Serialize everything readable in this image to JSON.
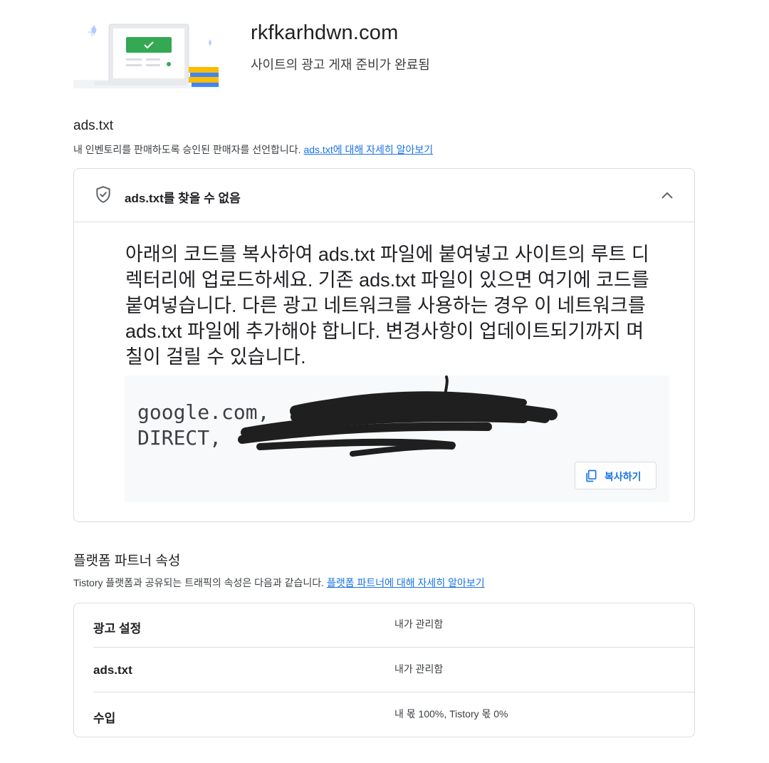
{
  "header": {
    "domain": "rkfkarhdwn.com",
    "status": "사이트의 광고 게재 준비가 완료됨"
  },
  "ads_txt_section": {
    "title": "ads.txt",
    "description": "내 인벤토리를 판매하도록 승인된 판매자를 선언합니다. ",
    "learn_more_link": "ads.txt에 대해 자세히 알아보기",
    "card": {
      "status_label": "ads.txt를 찾을 수 없음",
      "instructions": "아래의 코드를 복사하여 ads.txt 파일에 붙여넣고 사이트의 루트 디렉터리에 업로드하세요. 기존 ads.txt 파일이 있으면 여기에 코드를 붙여넣습니다. 다른 광고 네트워크를 사용하는 경우 이 네트워크를 ads.txt 파일에 추가해야 합니다. 변경사항이 업데이트되기까지 며칠이 걸릴 수 있습니다.",
      "code_line_1": "google.com,",
      "code_line_2": "DIRECT,",
      "copy_button": "복사하기"
    }
  },
  "platform_section": {
    "title": "플랫폼 파트너 속성",
    "description": "Tistory 플랫폼과 공유되는 트래픽의 속성은 다음과 같습니다. ",
    "learn_more_link": "플랫폼 파트너에 대해 자세히 알아보기",
    "rows": [
      {
        "label": "광고 설정",
        "value": "내가 관리함"
      },
      {
        "label": "ads.txt",
        "value": "내가 관리함"
      },
      {
        "label": "수입",
        "value": "내 몫 100%, Tistory 몫 0%"
      }
    ]
  },
  "colors": {
    "link": "#1a73e8",
    "border": "#dadce0",
    "check_green": "#34a853",
    "code_bg": "#f8f9fa"
  },
  "icons": [
    "site-illustration",
    "shield-check-icon",
    "chevron-up-icon",
    "copy-icon"
  ]
}
